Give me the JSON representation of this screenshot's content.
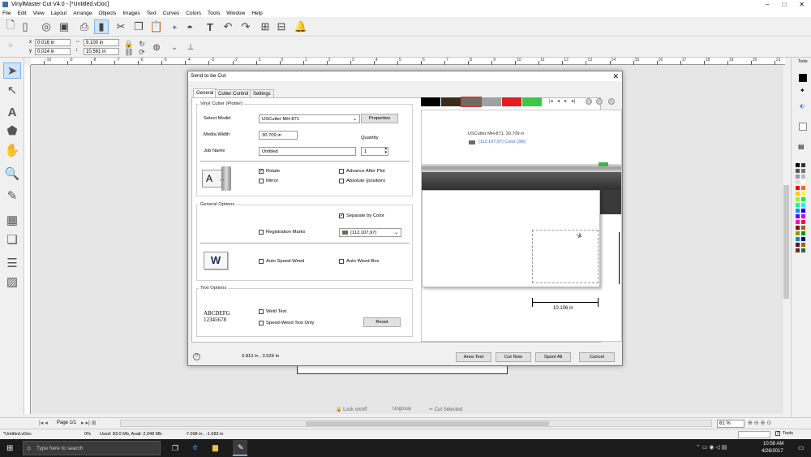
{
  "app": {
    "title": "VinylMaster Cut V4.0 - [*Untitled.vDoc]",
    "window_controls": [
      "–",
      "□",
      "✕"
    ]
  },
  "menu": [
    "File",
    "Edit",
    "View",
    "Layout",
    "Arrange",
    "Objects",
    "Images",
    "Text",
    "Curves",
    "Colors",
    "Tools",
    "Window",
    "Help"
  ],
  "coords": {
    "x_label": "x",
    "x_value": "0.016 in",
    "y_label": "y",
    "y_value": "0.024 in",
    "w_value": "9.100 in",
    "h_value": "10.561 in"
  },
  "ruler_labels": [
    "-10",
    "-9",
    "-8",
    "-7",
    "-6",
    "-5",
    "-4",
    "-3",
    "-2",
    "-1",
    "0",
    "1",
    "2",
    "3",
    "4",
    "5",
    "6",
    "7",
    "8",
    "9",
    "10",
    "11",
    "12",
    "13",
    "14",
    "15",
    "16",
    "17",
    "18",
    "19",
    "20",
    "21"
  ],
  "right_panel": {
    "header": "Tools"
  },
  "dialog": {
    "title": "Send to be Cut",
    "close": "✕",
    "tabs": [
      "General",
      "Cutter Control",
      "Settings"
    ],
    "vinyl_cutter": {
      "group": "Vinyl Cutter (Plotter)",
      "select_model_label": "Select Model",
      "select_model_value": "USCutter MH-871",
      "properties_button": "Properties",
      "media_width_label": "Media Width",
      "media_width_value": "30.709 in",
      "quantity_label": "Quantity",
      "quantity_value": "1",
      "job_name_label": "Job Name",
      "job_name_value": "Untitled",
      "rotate_label": "Rotate",
      "rotate_checked": true,
      "mirror_label": "Mirror",
      "advance_label": "Advance After Plot",
      "absolute_label": "Absolute (position)",
      "icon_letter": "A"
    },
    "general_options": {
      "group": "General Options",
      "separate_label": "Separate by Color",
      "separate_checked": true,
      "registration_label": "Registration Marks",
      "color_value": "(112,107,97)",
      "color_hex": "#706b61",
      "auto_speed_label": "Auto Speed-Weed",
      "auto_weed_label": "Auto Weed-Box",
      "icon_letter": "W"
    },
    "text_options": {
      "group": "Text Options",
      "sample_line1": "ABCDEFG",
      "sample_line2": "12345678",
      "weld_label": "Weld Text",
      "speed_weed_label": "Speed-Weed Text Only",
      "reset_button": "Reset"
    },
    "preview": {
      "swatches": [
        "#000000",
        "#3b2d1e",
        "#706b61",
        "#a0a0a0",
        "#e41e1e",
        "#3cc846"
      ],
      "info_line1": "USCutter MH-871,  30.709 in",
      "info_line2": "(112,107,97) Color (3/6)",
      "dimension": "10.106 in"
    },
    "footer": {
      "help_icon": "?",
      "coords": "3.812 in , 3.526 in",
      "area_test": "Area Test",
      "cut_now": "Cut Now",
      "spool_all": "Spool All",
      "cancel": "Cancel"
    }
  },
  "bottom_tools": {
    "lock": "Lock on/off",
    "ungroup": "Ungroup",
    "cut_selected": "Cut Selected"
  },
  "pagebar": {
    "page": "Page 1/1",
    "zoom": "61 %"
  },
  "statusbar": {
    "file": "*Untitled.vDoc",
    "percent": "0%",
    "memory": "Used: 83.0 Mb, Avail: 2,048 Mb",
    "cursor": "-7.098 in , -1.683 in",
    "tools": "Tools"
  },
  "taskbar": {
    "search_placeholder": "Type here to search",
    "time": "10:58 AM",
    "date": "4/26/2017"
  }
}
